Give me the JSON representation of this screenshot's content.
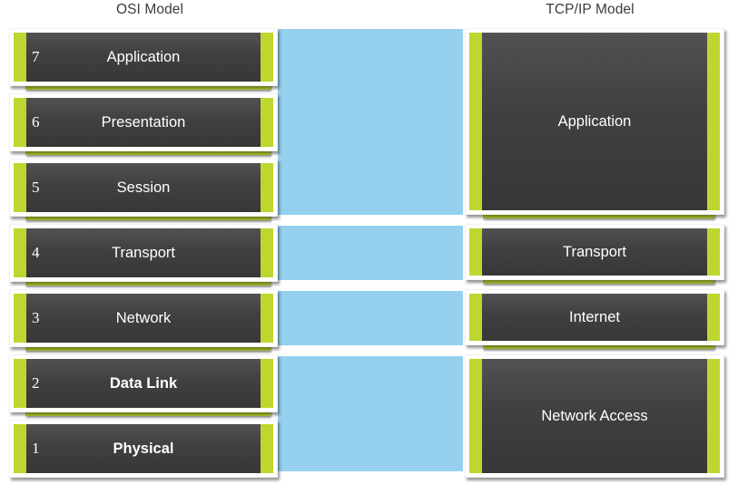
{
  "diagram": {
    "title_osi": "OSI Model",
    "title_tcpip": "TCP/IP Model",
    "colors": {
      "box_fill": "#413f3f",
      "accent_green": "#bed62f",
      "connector_blue": "#95d0ee",
      "title_text": "#3b3b42",
      "label_text": "#ffffff",
      "page_background": "#ffffff"
    }
  },
  "osi": {
    "heading": "OSI Model",
    "layers": [
      {
        "number": "7",
        "label": "Application"
      },
      {
        "number": "6",
        "label": "Presentation"
      },
      {
        "number": "5",
        "label": "Session"
      },
      {
        "number": "4",
        "label": "Transport"
      },
      {
        "number": "3",
        "label": "Network"
      },
      {
        "number": "2",
        "label": "Data Link"
      },
      {
        "number": "1",
        "label": "Physical"
      }
    ]
  },
  "tcpip": {
    "heading": "TCP/IP Model",
    "layers": [
      {
        "label": "Application"
      },
      {
        "label": "Transport"
      },
      {
        "label": "Internet"
      },
      {
        "label": "Network Access"
      }
    ]
  },
  "connectors": [
    {
      "maps_to": "Application"
    },
    {
      "maps_to": "Transport"
    },
    {
      "maps_to": "Internet"
    },
    {
      "maps_to": "Network Access"
    }
  ]
}
